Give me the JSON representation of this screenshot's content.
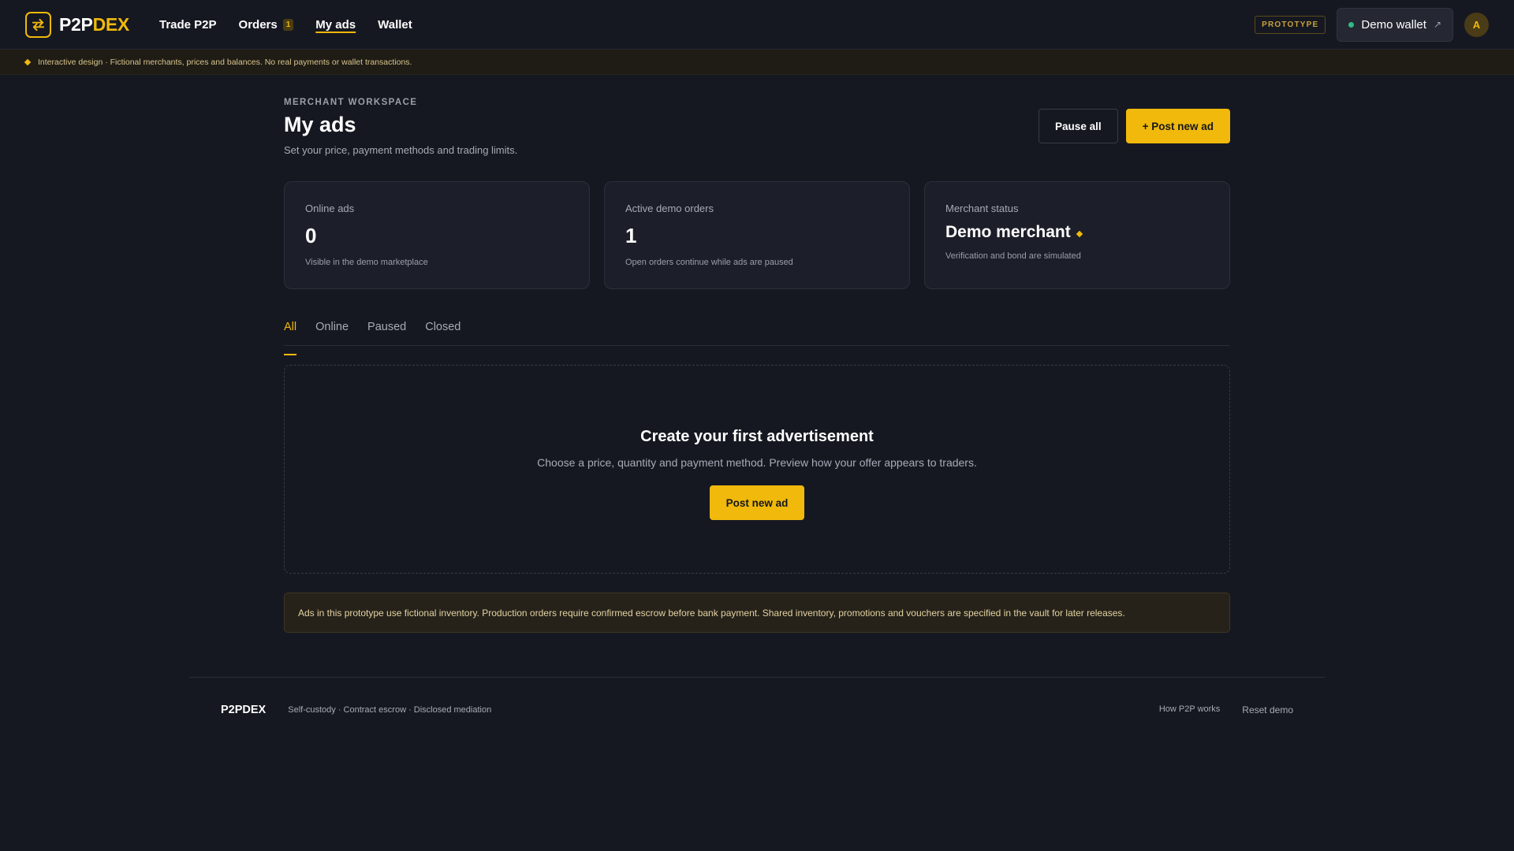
{
  "header": {
    "brand_part1": "P2P",
    "brand_part2": "DEX",
    "nav": [
      {
        "label": "Trade P2P"
      },
      {
        "label": "Orders",
        "badge": "1"
      },
      {
        "label": "My ads"
      },
      {
        "label": "Wallet"
      }
    ],
    "prototype_label": "PROTOTYPE",
    "wallet_label": "Demo wallet",
    "wallet_ext_icon": "↗",
    "avatar_initial": "A"
  },
  "notice": {
    "text": "Interactive design · Fictional merchants, prices and balances. No real payments or wallet transactions."
  },
  "page": {
    "eyebrow": "MERCHANT WORKSPACE",
    "title": "My ads",
    "subtitle": "Set your price, payment methods and trading limits.",
    "pause_all_label": "Pause all",
    "post_new_ad_label": "+ Post new ad"
  },
  "stats": [
    {
      "label": "Online ads",
      "value": "0",
      "hint": "Visible in the demo marketplace"
    },
    {
      "label": "Active demo orders",
      "value": "1",
      "hint": "Open orders continue while ads are paused"
    },
    {
      "label": "Merchant status",
      "value": "Demo merchant",
      "hint": "Verification and bond are simulated"
    }
  ],
  "tabs": [
    {
      "label": "All"
    },
    {
      "label": "Online"
    },
    {
      "label": "Paused"
    },
    {
      "label": "Closed"
    }
  ],
  "empty_state": {
    "title": "Create your first advertisement",
    "description": "Choose a price, quantity and payment method. Preview how your offer appears to traders.",
    "button_label": "Post new ad"
  },
  "info_bar": {
    "text": "Ads in this prototype use fictional inventory. Production orders require confirmed escrow before bank payment. Shared inventory, promotions and vouchers are specified in the vault for later releases."
  },
  "footer": {
    "brand": "P2PDEX",
    "tagline": "Self-custody · Contract escrow · Disclosed mediation",
    "links": [
      {
        "label": "How P2P works"
      },
      {
        "label": "Reset demo"
      }
    ]
  },
  "colors": {
    "accent": "#f0b90b",
    "background": "#161821",
    "card": "#1c1f29",
    "online_dot": "#2ebd85"
  }
}
